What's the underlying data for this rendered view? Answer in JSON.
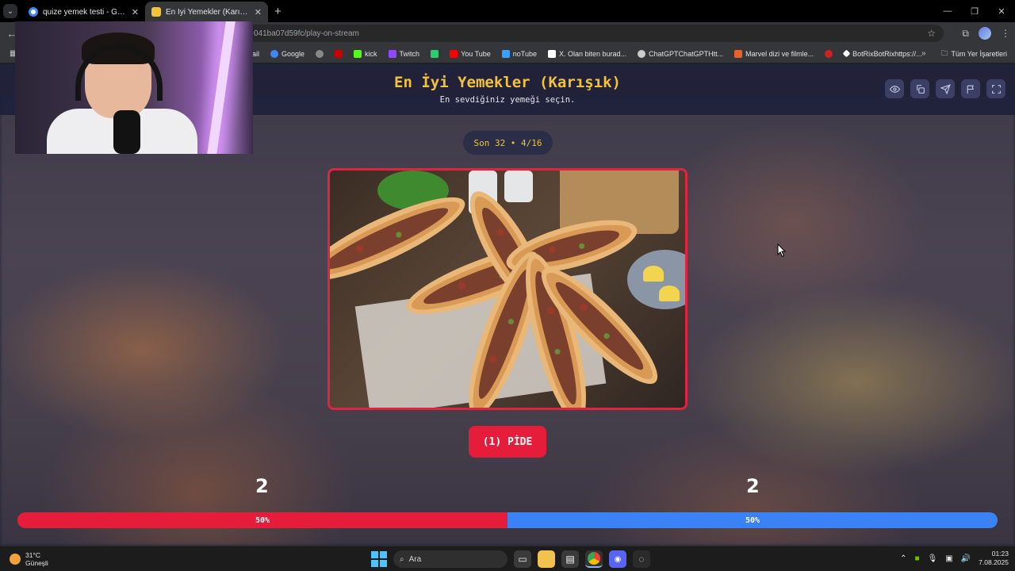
{
  "browser": {
    "tabs": [
      {
        "title": "quize yemek testi - Google'da A",
        "active": false
      },
      {
        "title": "En İyi Yemekler (Karışık) - Quize",
        "active": true
      }
    ],
    "new_tab_label": "+",
    "url": "041ba07d59fc/play-on-stream",
    "bookmarks": [
      {
        "label": "Gmail",
        "visible_label": "ail",
        "icon_color": "#ea4335"
      },
      {
        "label": "Google",
        "icon_color": "#4285f4"
      },
      {
        "label": "",
        "icon_color": "#888888"
      },
      {
        "label": "",
        "icon_color": "#cc0000"
      },
      {
        "label": "kick",
        "icon_color": "#53fc18"
      },
      {
        "label": "Twitch",
        "icon_color": "#9146ff"
      },
      {
        "label": "",
        "icon_color": "#2ecc71"
      },
      {
        "label": "You Tube",
        "icon_color": "#ff0000"
      },
      {
        "label": "noTube",
        "icon_color": "#3aa0ff"
      },
      {
        "label": "X. Olan biten burad...",
        "icon_color": "#ffffff"
      },
      {
        "label": "ChatGPTChatGPTHtt...",
        "icon_color": "#cccccc"
      },
      {
        "label": "Marvel dizi ve filmle...",
        "icon_color": "#e8612c"
      },
      {
        "label": "",
        "icon_color": "#cc2222"
      },
      {
        "label": "BotRixBotRixhttps://...",
        "icon_color": "#ffffff"
      }
    ],
    "bookmarks_overflow": "»",
    "all_bookmarks": "Tüm Yer İşaretleri"
  },
  "quiz": {
    "title": "En İyi Yemekler (Karışık)",
    "subtitle": "En sevdiğiniz yemeği seçin.",
    "round": "Son 32 • 4/16",
    "header_buttons": [
      "eye-icon",
      "copy-icon",
      "send-icon",
      "flag-icon",
      "fullscreen-icon"
    ],
    "choice_label": "(1) PİDE",
    "left_score": "2",
    "right_score": "2",
    "left_percent": "50%",
    "right_percent": "50%",
    "left_fraction": 0.5,
    "accent_red": "#e51d3b",
    "accent_blue": "#3b82f6",
    "title_color": "#f2c33a"
  },
  "taskbar": {
    "weather_temp": "31°C",
    "weather_desc": "Güneşli",
    "search_placeholder": "Ara",
    "time": "01:23",
    "date": "7.08.2025"
  }
}
